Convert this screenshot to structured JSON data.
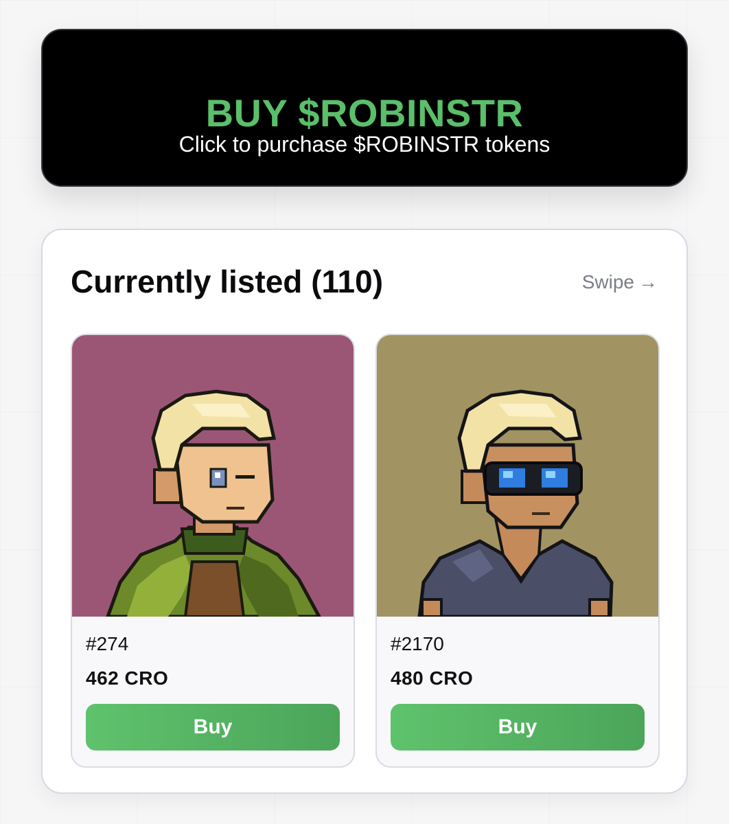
{
  "banner": {
    "title": "BUY $ROBINSTR",
    "subtitle": "Click to purchase $ROBINSTR tokens",
    "title_color": "#5bbf6a",
    "background_color": "#000000"
  },
  "listing": {
    "title": "Currently listed (110)",
    "swipe_label": "Swipe",
    "swipe_icon": "arrow-right-icon",
    "items": [
      {
        "id_label": "#274",
        "price": "462 CRO",
        "buy_label": "Buy",
        "art_background": "#9b5676",
        "art_description_icon": "pixel-avatar-green-cloak-icon"
      },
      {
        "id_label": "#2170",
        "price": "480 CRO",
        "buy_label": "Buy",
        "art_background": "#a19462",
        "art_description_icon": "pixel-avatar-goggles-icon"
      }
    ]
  },
  "colors": {
    "accent_green": "#5bbf6a",
    "page_background": "#f6f6f7"
  }
}
